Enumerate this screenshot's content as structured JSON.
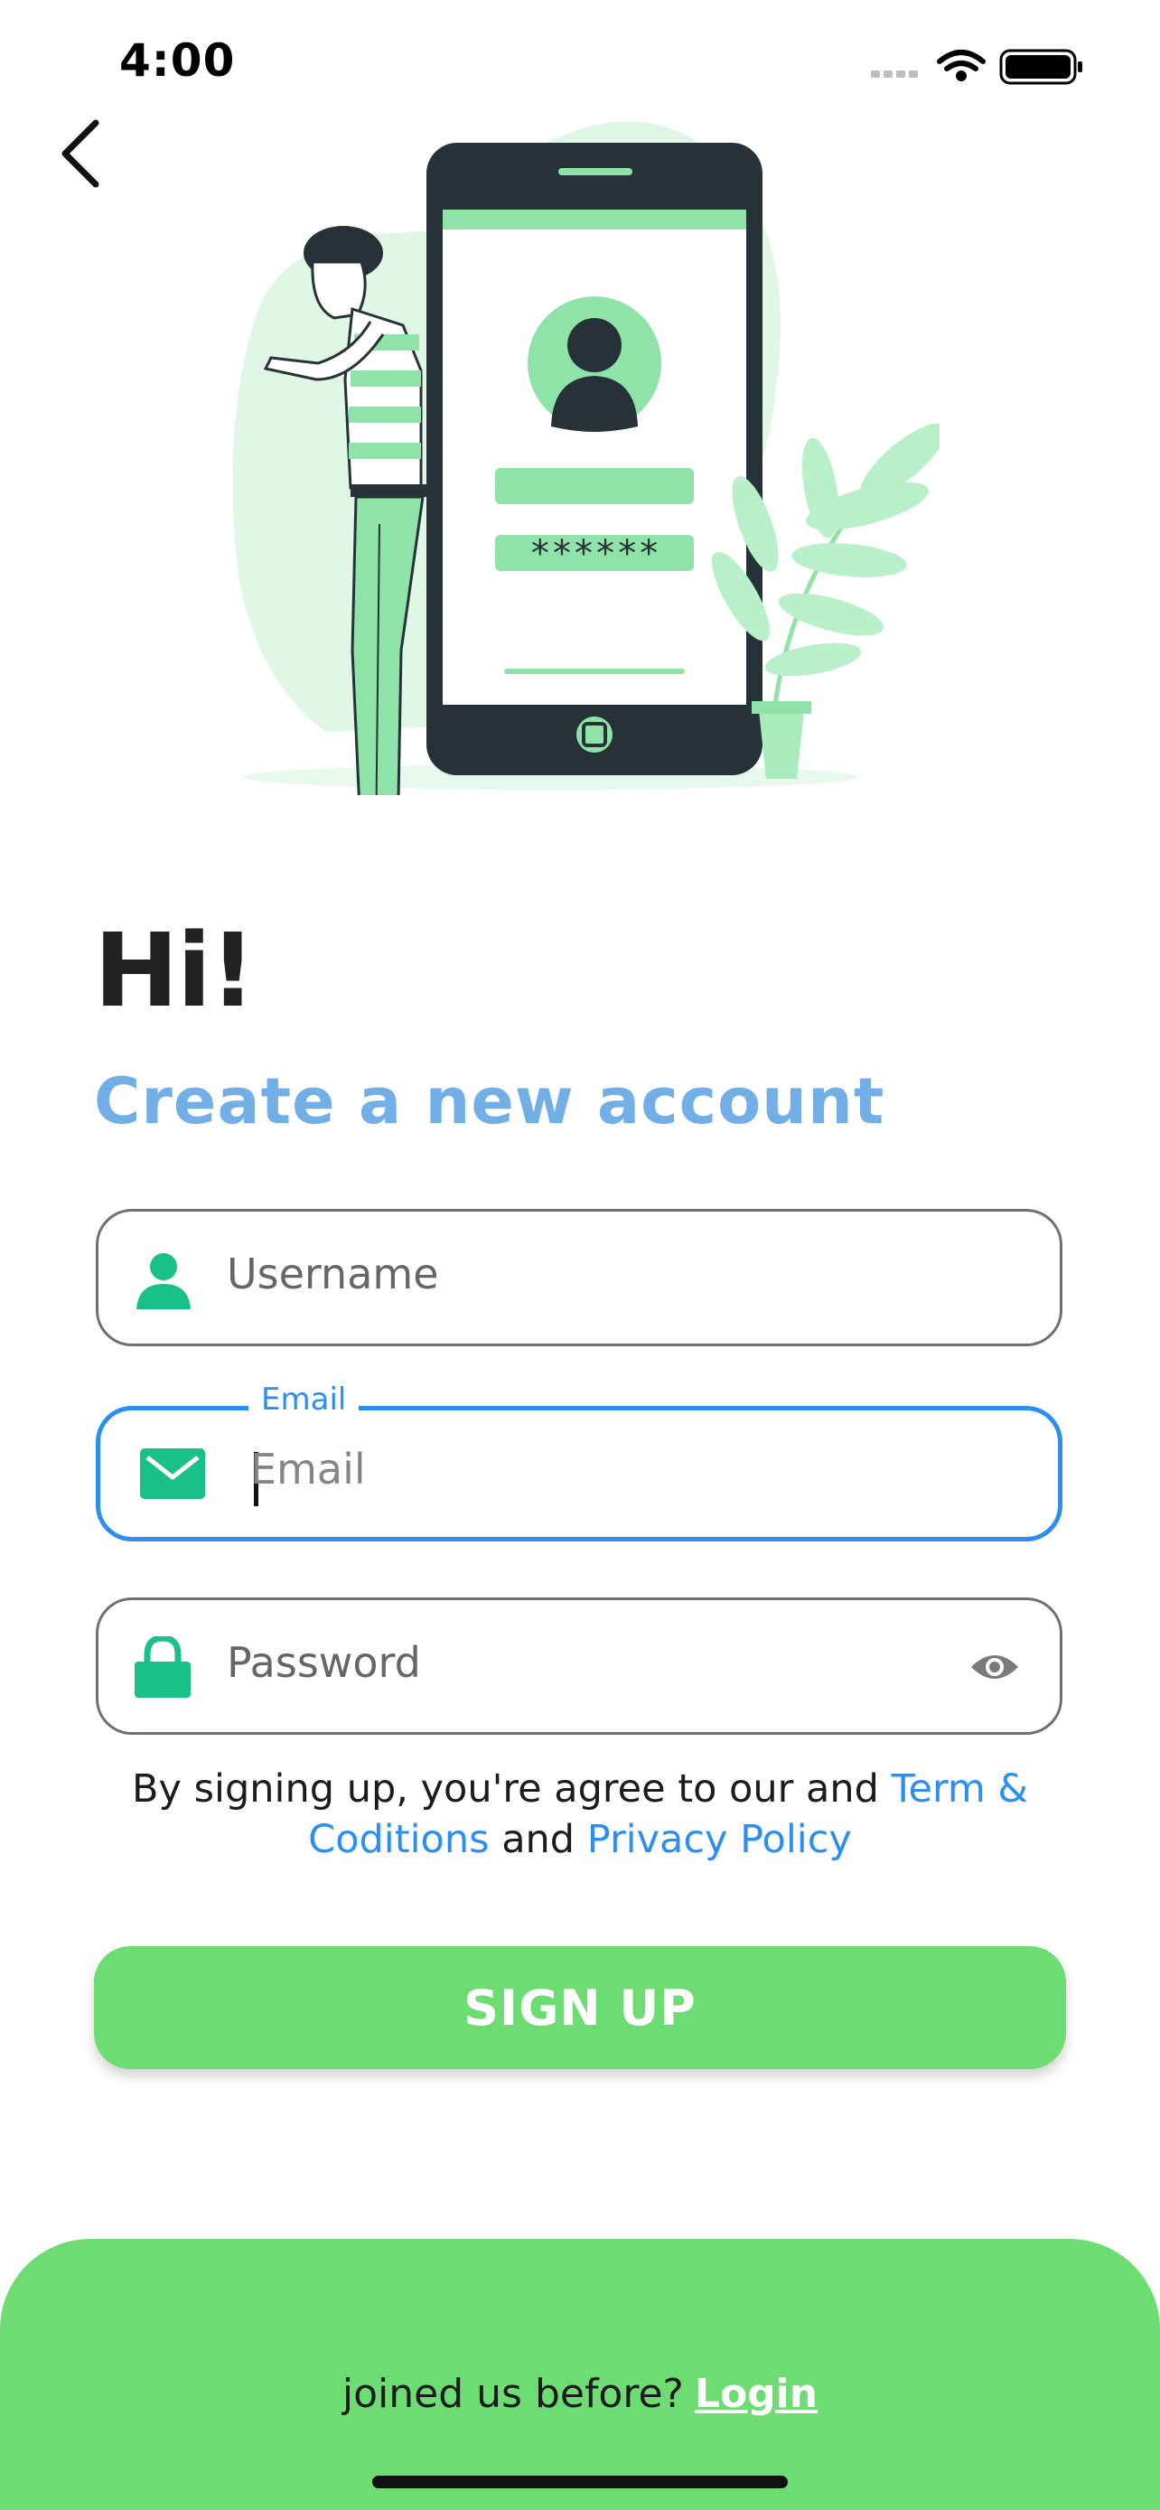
{
  "status_bar": {
    "time": "4:00"
  },
  "header": {
    "back_icon": "chevron-left-icon"
  },
  "illustration": {
    "password_mask": "******"
  },
  "heading": {
    "title": "Hi!",
    "subtitle": "Create a new account"
  },
  "form": {
    "username": {
      "placeholder": "Username",
      "icon": "user-icon"
    },
    "email": {
      "label": "Email",
      "placeholder": "Email",
      "icon": "mail-icon"
    },
    "password": {
      "placeholder": "Password",
      "icon": "lock-icon",
      "toggle_icon": "eye-icon"
    }
  },
  "terms": {
    "prefix": "By signing up, you're agree to our and ",
    "link1": "Term & Coditions",
    "middle": " and ",
    "link2": "Privacy Policy"
  },
  "signup_button": {
    "label": "SIGN UP"
  },
  "footer": {
    "prompt": "joined us before?",
    "login_link": "Login"
  },
  "colors": {
    "accent_green": "#6ddc72",
    "icon_green": "#19c087",
    "link_blue": "#2a8ff0",
    "subtitle_blue": "#72afe6"
  }
}
